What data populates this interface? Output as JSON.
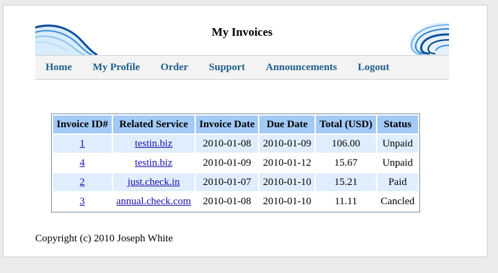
{
  "header": {
    "title": "My Invoices"
  },
  "nav": {
    "items": [
      "Home",
      "My Profile",
      "Order",
      "Support",
      "Announcements",
      "Logout"
    ]
  },
  "table": {
    "headers": [
      "Invoice ID#",
      "Related Service",
      "Invoice Date",
      "Due Date",
      "Total (USD)",
      "Status"
    ],
    "rows": [
      {
        "id": "1",
        "service": "testin.biz",
        "invoice_date": "2010-01-08",
        "due_date": "2010-01-09",
        "total": "106.00",
        "status": "Unpaid"
      },
      {
        "id": "4",
        "service": "testin.biz",
        "invoice_date": "2010-01-09",
        "due_date": "2010-01-12",
        "total": "15.67",
        "status": "Unpaid"
      },
      {
        "id": "2",
        "service": "just.check.in",
        "invoice_date": "2010-01-07",
        "due_date": "2010-01-10",
        "total": "15.21",
        "status": "Paid"
      },
      {
        "id": "3",
        "service": "annual.check.com",
        "invoice_date": "2010-01-08",
        "due_date": "2010-01-10",
        "total": "11.11",
        "status": "Cancled"
      }
    ]
  },
  "footer": {
    "copyright": "Copyright (c) 2010 Joseph White"
  },
  "colors": {
    "nav_link": "#1e5f8c",
    "table_header_bg": "#a3caf6",
    "row_alt_bg": "#dfeefd",
    "link": "#1a0dab"
  },
  "icons": {
    "left_decoration": "blue-wave-swoosh",
    "right_decoration": "blue-swirl-swoosh"
  }
}
